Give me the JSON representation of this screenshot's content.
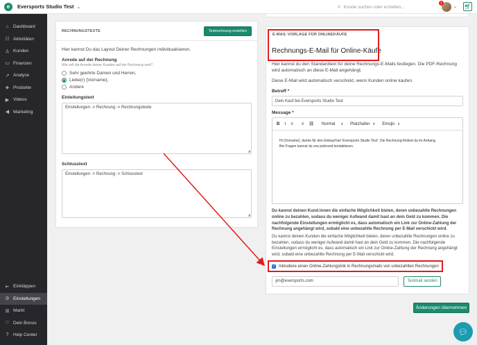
{
  "topbar": {
    "logo_letter": "e",
    "studio_name": "Eversports Studio Test",
    "search_placeholder": "Kunde suchen oder erstellen...",
    "notification_count": "1"
  },
  "sidebar": {
    "items": [
      {
        "label": "Dashboard",
        "icon": "home-icon"
      },
      {
        "label": "Aktivitäten",
        "icon": "calendar-icon"
      },
      {
        "label": "Kunden",
        "icon": "user-icon"
      },
      {
        "label": "Finanzen",
        "icon": "money-icon"
      },
      {
        "label": "Analyse",
        "icon": "chart-icon"
      },
      {
        "label": "Produkte",
        "icon": "box-icon"
      },
      {
        "label": "Videos",
        "icon": "video-icon"
      },
      {
        "label": "Marketing",
        "icon": "megaphone-icon"
      }
    ],
    "bottom_items": [
      {
        "label": "Einkläppen",
        "icon": "collapse-icon"
      },
      {
        "label": "Einstellungen",
        "icon": "gear-icon",
        "active": true
      },
      {
        "label": "Markt",
        "icon": "plus-square-icon"
      },
      {
        "label": "Dein Bonus",
        "icon": "heart-icon"
      },
      {
        "label": "Help Center",
        "icon": "help-icon"
      }
    ]
  },
  "left_panel": {
    "header": "RECHNUNGSTEXTE",
    "test_button": "Testrechnung erstellen",
    "intro": "Hier kannst Du das Layout Deiner Rechnungen individualisieren.",
    "salutation_label": "Anrede auf der Rechnung",
    "salutation_hint": "Wie soll die Anrede deiner Kunden auf der Rechnung sein?",
    "options": [
      "Sehr geehrte Damen und Herren,",
      "Liebe(r) {Vorname},",
      "Andere"
    ],
    "selected_option": 1,
    "intro_text_label": "Einleitungstext",
    "intro_text_value": "Einstellungen  -> Rechnung -> Rechnungstexte",
    "closing_label": "Schlusstext",
    "closing_value": "Einstellungen  -> Rechnung -> Schlusstext"
  },
  "right_panel": {
    "section_label": "E-MAIL VORLAGE FÜR ONLINEKÄUFE",
    "title": "Rechnungs-E-Mail für Online-Käufe",
    "desc1": "Hier kannst du den Standardtext für deine Rechnungs-E-Mails festlegen. Die PDF-Rechnung wird automatisch an diese E-Mail angehängt.",
    "desc2": "Diese E-Mail wird automatisch verschickt, wenn Kunden online kaufen.",
    "subject_label": "Betreff *",
    "subject_value": "Dein Kauf bei Eversports Studio Test",
    "message_label": "Message *",
    "toolbar": {
      "bold": "B",
      "italic": "I",
      "numbered_list": "≡",
      "bullet_list": "≡",
      "link": "⛓",
      "format": "Normal",
      "placeholder": "Platzhalter",
      "emojis": "Emojis"
    },
    "message_line1": "Hi {Vorname}, danke für den Einkauf bei 'Eversports Studio Test'. Die Rechnung findest du im Anhang.",
    "message_line2": "Bei Fragen kannst du uns jederzeit kontaktieren.",
    "info_bold": "Du kannst deinen Kund:innen die einfache Möglichkeit bieten, deren unbezahlte Rechnungen online zu bezahlen, sodass du weniger Aufwand damit hast an dein Geld zu kommen. Die nachfolgende Einstellungen ermöglicht es, dass automatisch ein Link zur Online-Zahlung der Rechnung angehängt wird, sobald eine unbezahlte Rechnung per E-Mail verschickt wird.",
    "info_plain": "Du kannst deinen Kunden die einfache Möglichkeit bieten, deren unbezahlte Rechnungen online zu bezahlen, sodass du weniger Aufwand damit hast an dein Geld zu kommen. Die nachfolgende Einstellungen ermöglicht es, dass automatisch ein Link zur Online-Zahlung der Rechnung angehängt wird, sobald eine unbezahlte Rechnung per E-Mail verschickt wird.",
    "checkbox_label": "Inkludiere einen Online-Zahlungslink in Rechnungsmails von unbezahlten Rechnungen",
    "checkbox_checked": "✓",
    "test_email_value": "yin@eversports.com",
    "test_mail_button": "Testmail senden"
  },
  "apply_button": "Änderungen übernehmen",
  "colors": {
    "accent": "#1b8a6e",
    "highlight": "#e01b1b",
    "sidebar": "#26262b"
  }
}
